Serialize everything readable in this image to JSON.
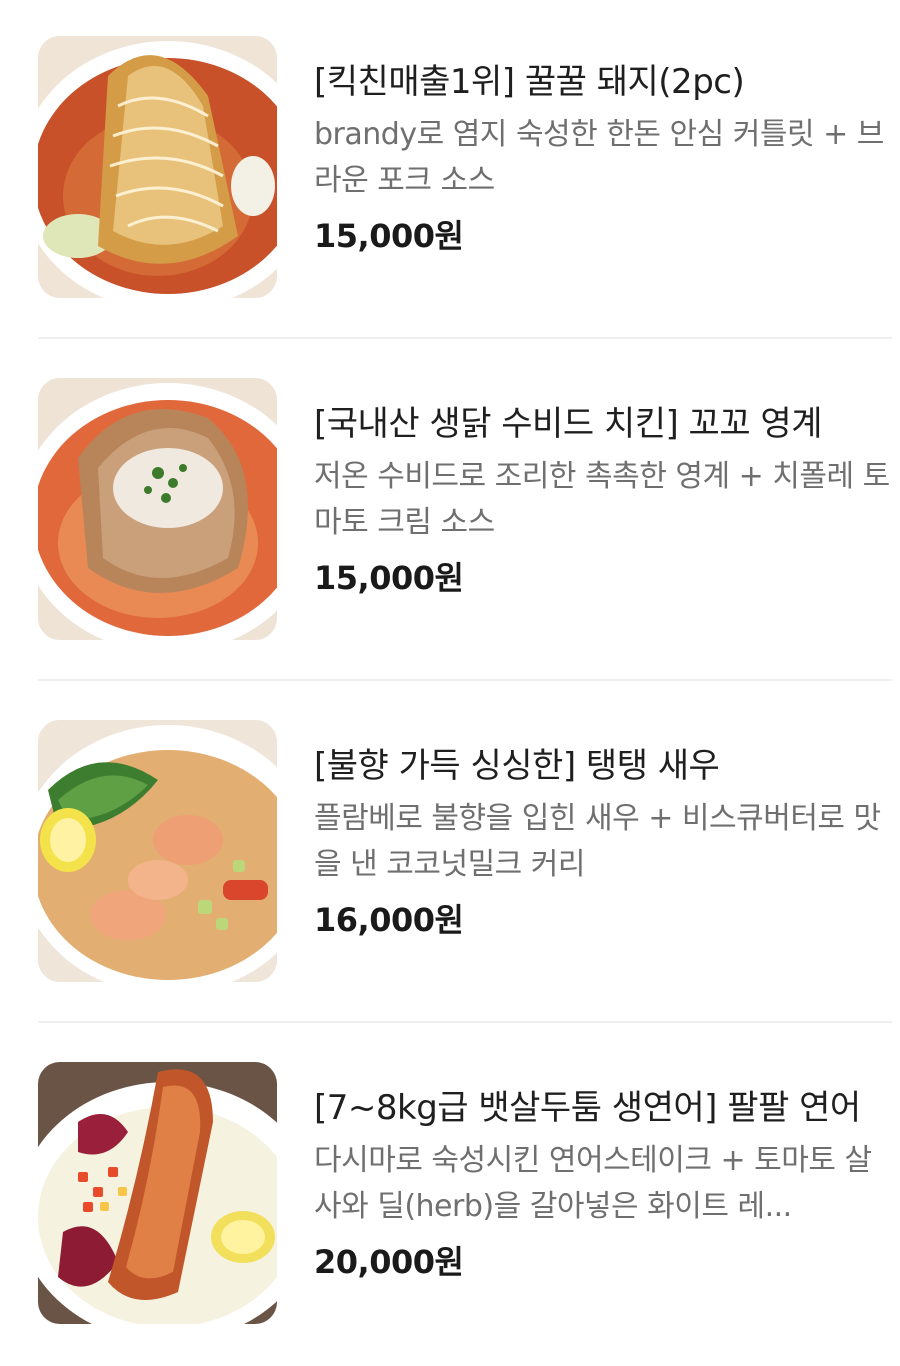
{
  "menu": {
    "items": [
      {
        "title": "[킥친매출1위] 꿀꿀 돼지(2pc)",
        "description": "brandy로 염지 숙성한 한돈 안심 커틀릿 + 브라운 포크 소스",
        "price": "15,000원",
        "image": "pork-cutlet-curry-photo"
      },
      {
        "title": "[국내산 생닭 수비드 치킨] 꼬꼬 영계",
        "description": "저온 수비드로 조리한 촉촉한 영계 + 치폴레 토마토 크림 소스",
        "price": "15,000원",
        "image": "sous-vide-chicken-curry-photo"
      },
      {
        "title": "[불향 가득 싱싱한] 탱탱 새우",
        "description": "플람베로 불향을 입힌 새우 + 비스큐버터로 맛을 낸 코코넛밀크 커리",
        "price": "16,000원",
        "image": "shrimp-coconut-curry-photo"
      },
      {
        "title": "[7~8kg급 뱃살두툼 생연어] 팔팔 연어",
        "description": "다시마로 숙성시킨 연어스테이크 + 토마토 살사와 딜(herb)을 갈아넣은 화이트 레...",
        "price": "20,000원",
        "image": "salmon-steak-white-curry-photo"
      }
    ]
  },
  "colors": {
    "title": "#1f1f1f",
    "description": "#6f6f6f",
    "price": "#1a1a1a",
    "divider": "#f0f0f0"
  }
}
